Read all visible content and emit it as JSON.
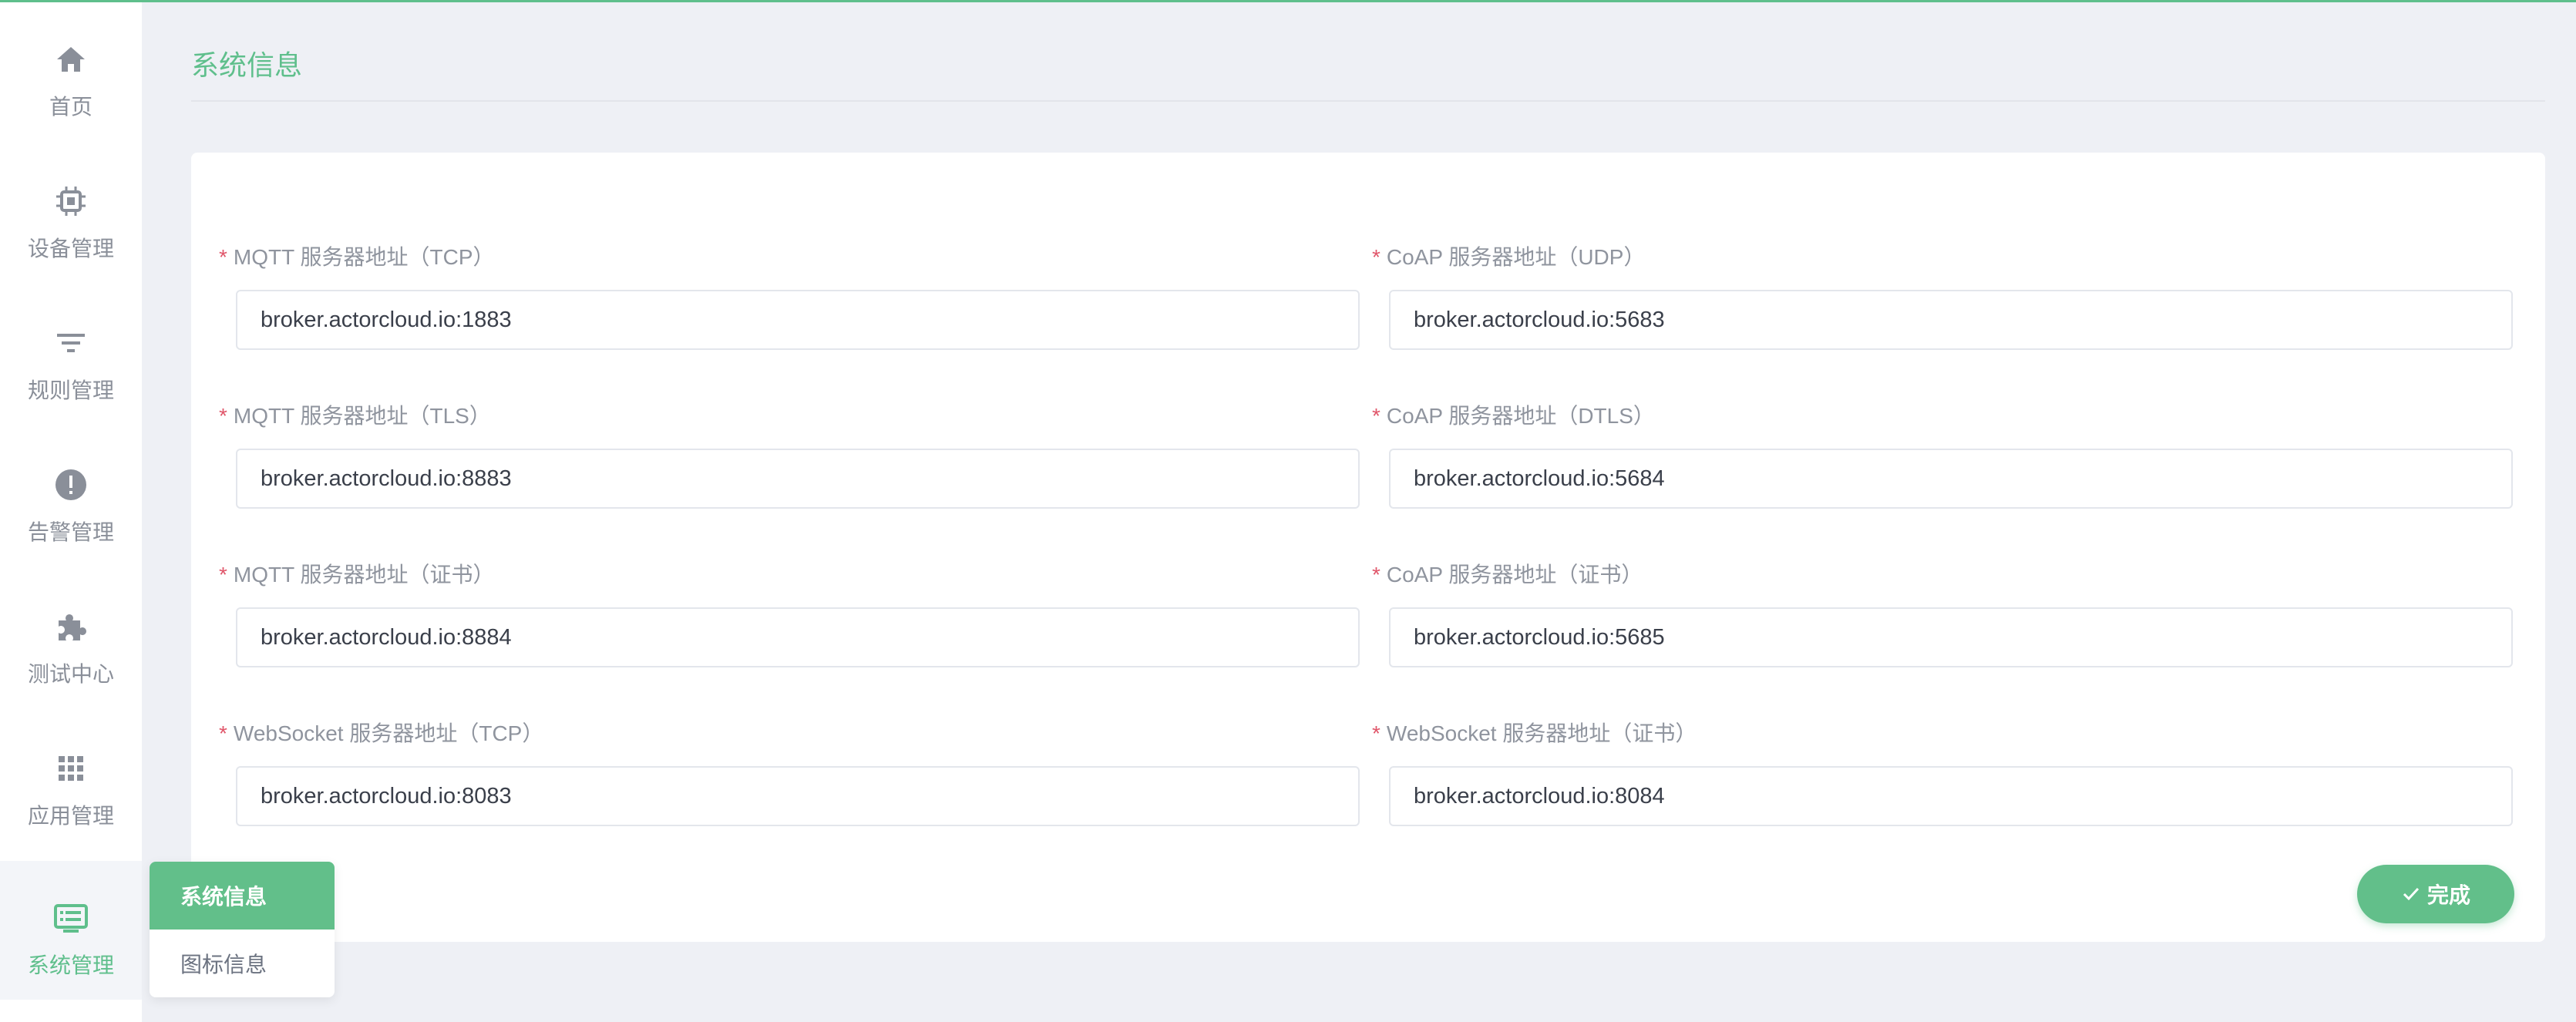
{
  "header": {
    "title": "系统信息"
  },
  "sidebar": {
    "items": [
      {
        "label": "首页",
        "icon": "home-icon"
      },
      {
        "label": "设备管理",
        "icon": "chip-icon"
      },
      {
        "label": "规则管理",
        "icon": "filter-icon"
      },
      {
        "label": "告警管理",
        "icon": "alert-icon"
      },
      {
        "label": "测试中心",
        "icon": "puzzle-icon"
      },
      {
        "label": "应用管理",
        "icon": "grid-apps-icon"
      },
      {
        "label": "系统管理",
        "icon": "monitor-list-icon"
      }
    ],
    "active_index": 6,
    "submenu": [
      {
        "label": "系统信息"
      },
      {
        "label": "图标信息"
      }
    ]
  },
  "form": {
    "fields": [
      {
        "label": "MQTT 服务器地址（TCP）",
        "value": "broker.actorcloud.io:1883",
        "required": "*"
      },
      {
        "label": "CoAP 服务器地址（UDP）",
        "value": "broker.actorcloud.io:5683",
        "required": "*"
      },
      {
        "label": "MQTT 服务器地址（TLS）",
        "value": "broker.actorcloud.io:8883",
        "required": "*"
      },
      {
        "label": "CoAP 服务器地址（DTLS）",
        "value": "broker.actorcloud.io:5684",
        "required": "*"
      },
      {
        "label": "MQTT 服务器地址（证书）",
        "value": "broker.actorcloud.io:8884",
        "required": "*"
      },
      {
        "label": "CoAP 服务器地址（证书）",
        "value": "broker.actorcloud.io:5685",
        "required": "*"
      },
      {
        "label": "WebSocket 服务器地址（TCP）",
        "value": "broker.actorcloud.io:8083",
        "required": "*"
      },
      {
        "label": "WebSocket 服务器地址（证书）",
        "value": "broker.actorcloud.io:8084",
        "required": "*"
      }
    ],
    "done_label": "完成"
  },
  "colors": {
    "accent": "#5fbf8c",
    "required": "#e0566a",
    "muted_text": "#8a8f99"
  }
}
